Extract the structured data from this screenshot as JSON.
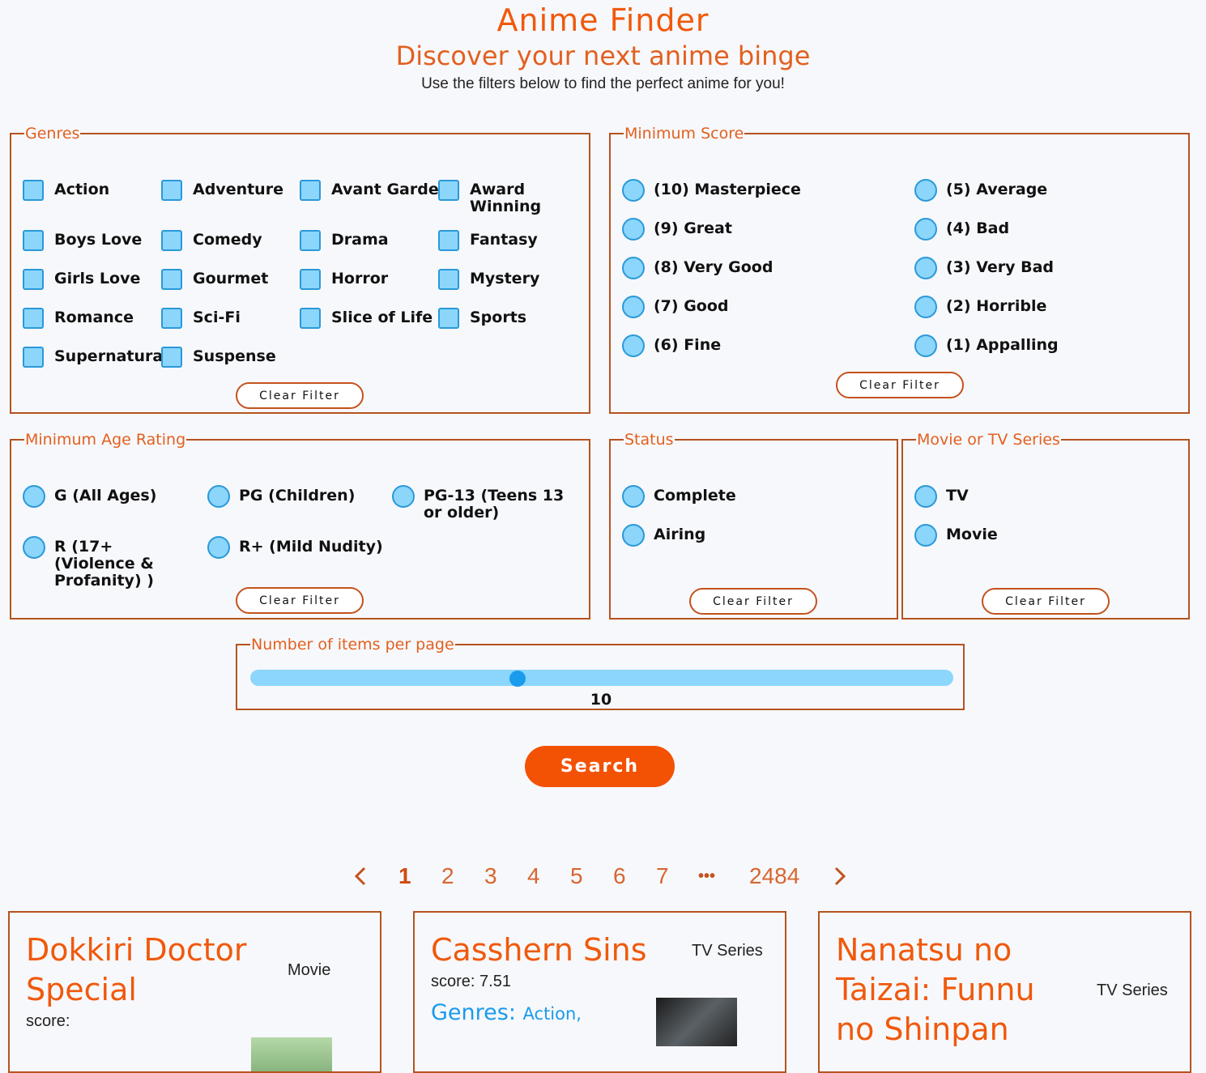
{
  "header": {
    "title": "Anime Finder",
    "subtitle": "Discover your next anime binge",
    "lead": "Use the filters below to find the perfect anime for you!"
  },
  "genres": {
    "legend": "Genres",
    "items": [
      "Action",
      "Adventure",
      "Avant Garde",
      "Award Winning",
      "Boys Love",
      "Comedy",
      "Drama",
      "Fantasy",
      "Girls Love",
      "Gourmet",
      "Horror",
      "Mystery",
      "Romance",
      "Sci-Fi",
      "Slice of Life",
      "Sports",
      "Supernatural",
      "Suspense"
    ],
    "clear": "Clear Filter"
  },
  "score": {
    "legend": "Minimum Score",
    "items": [
      "(10) Masterpiece",
      "(5) Average",
      "(9) Great",
      "(4) Bad",
      "(8) Very Good",
      "(3) Very Bad",
      "(7) Good",
      "(2) Horrible",
      "(6) Fine",
      "(1) Appalling"
    ],
    "clear": "Clear Filter"
  },
  "age": {
    "legend": "Minimum Age Rating",
    "items": [
      "G (All Ages)",
      "PG (Children)",
      "PG-13 (Teens 13 or older)",
      "R (17+ (Violence & Profanity) )",
      "R+ (Mild Nudity)"
    ],
    "clear": "Clear Filter"
  },
  "status": {
    "legend": "Status",
    "items": [
      "Complete",
      "Airing"
    ],
    "clear": "Clear Filter"
  },
  "media": {
    "legend": "Movie or TV Series",
    "items": [
      "TV",
      "Movie"
    ],
    "clear": "Clear Filter"
  },
  "per_page": {
    "legend": "Number of items per page",
    "value": "10",
    "fraction": 0.38
  },
  "search": {
    "label": "Search"
  },
  "pager": {
    "pages": [
      "1",
      "2",
      "3",
      "4",
      "5",
      "6",
      "7"
    ],
    "ellipsis": "•••",
    "last": "2484",
    "current": "1"
  },
  "cards": [
    {
      "title": "Dokkiri Doctor Special",
      "type": "Movie",
      "score": "score:"
    },
    {
      "title": "Casshern Sins",
      "type": "TV Series",
      "score": "score: 7.51",
      "genres_label": "Genres:",
      "genres": "Action,"
    },
    {
      "title": "Nanatsu no Taizai: Funnu no Shinpan",
      "type": "TV Series"
    }
  ],
  "colors": {
    "accent": "#f0590c",
    "border": "#b5531f",
    "control": "#8cd6fb",
    "control_border": "#2a99d9",
    "button": "#f35205"
  }
}
